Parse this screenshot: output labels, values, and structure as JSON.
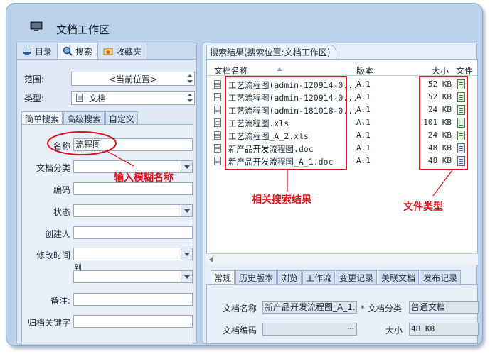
{
  "window": {
    "title": "文档工作区"
  },
  "left_tabs": [
    {
      "label": "目录",
      "icon": "catalog-icon"
    },
    {
      "label": "搜索",
      "icon": "search-icon"
    },
    {
      "label": "收藏夹",
      "icon": "favorites-icon"
    }
  ],
  "scope": {
    "label": "范围:",
    "value": "<当前位置>"
  },
  "type": {
    "label": "类型:",
    "value": "文档"
  },
  "search_tabs": [
    "简单搜索",
    "高级搜索",
    "自定义"
  ],
  "form": {
    "name_label": "名称",
    "name_value": "流程图",
    "category_label": "文档分类",
    "code_label": "编码",
    "status_label": "状态",
    "creator_label": "创建人",
    "modified_label": "修改时间",
    "to_label": "到",
    "remark_label": "备注:",
    "keyword_label": "归档关键字"
  },
  "results": {
    "tab_label": "搜索结果(搜索位置:文档工作区)",
    "columns": {
      "name": "文档名称",
      "version": "版本",
      "size": "大小",
      "type": "文件"
    },
    "rows": [
      {
        "name": "工艺流程图(admin-120914-0...",
        "version": "A.1",
        "size": "52 KB",
        "file_type": "xls"
      },
      {
        "name": "工艺流程图(admin-120914-0...",
        "version": "A.1",
        "size": "52 KB",
        "file_type": "xls"
      },
      {
        "name": "工艺流程图(admin-181018-0...",
        "version": "A.1",
        "size": "24 KB",
        "file_type": "xls"
      },
      {
        "name": "工艺流程图.xls",
        "version": "A.1",
        "size": "101 KB",
        "file_type": "xls"
      },
      {
        "name": "工艺流程图_A_2.xls",
        "version": "A.1",
        "size": "24 KB",
        "file_type": "xls"
      },
      {
        "name": "新产品开发流程图.doc",
        "version": "A.1",
        "size": "48 KB",
        "file_type": "doc"
      },
      {
        "name": "新产品开发流程图_A_1.doc",
        "version": "A.1",
        "size": "48 KB",
        "file_type": "doc"
      }
    ]
  },
  "bottom_tabs": [
    "常规",
    "历史版本",
    "浏览",
    "工作流",
    "变更记录",
    "关联文档",
    "发布记录"
  ],
  "detail": {
    "doc_name_label": "文档名称",
    "doc_name_value": "新产品开发流程图_A_1.",
    "doc_category_label": "* 文档分类",
    "doc_category_value": "普通文档",
    "doc_code_label": "文档编码",
    "doc_code_value": "",
    "size_label": "大小",
    "size_value": "48 KB",
    "browse_label": "..."
  },
  "annotations": {
    "fuzzy_name": "输入模糊名称",
    "related_results": "相关搜索结果",
    "file_type": "文件类型"
  },
  "colors": {
    "annotation": "#e0101a",
    "frame": "#bcd2ec"
  }
}
